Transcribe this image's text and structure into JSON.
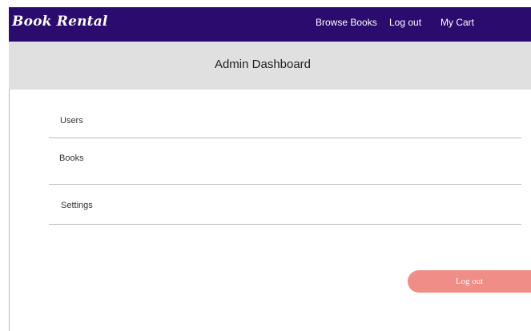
{
  "navbar": {
    "brand": "Book Rental",
    "links": {
      "browse_books": "Browse Books",
      "log_out": "Log out",
      "my_cart": "My Cart"
    }
  },
  "header": {
    "title": "Admin Dashboard"
  },
  "menu": {
    "items": [
      {
        "label": "Users"
      },
      {
        "label": "Books"
      },
      {
        "label": "Settings"
      }
    ]
  },
  "actions": {
    "logout_label": "Log out"
  },
  "colors": {
    "navbar_bg": "#2c0b6e",
    "title_band_bg": "#e0e0e0",
    "logout_button_bg": "#f08d86"
  }
}
